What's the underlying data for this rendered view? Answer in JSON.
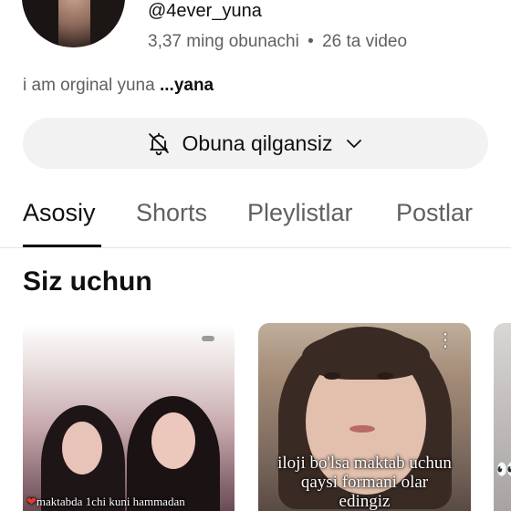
{
  "channel": {
    "handle": "@4ever_yuna",
    "subscribers": "3,37 ming obunachi",
    "separator": "•",
    "videos": "26 ta video",
    "bio": "i am orginal yuna",
    "bio_more": "...yana"
  },
  "subscribe_button": {
    "label": "Obuna qilgansiz",
    "icon": "bell-off-icon",
    "chevron": "chevron-down-icon"
  },
  "tabs": [
    {
      "label": "Asosiy",
      "active": true
    },
    {
      "label": "Shorts",
      "active": false
    },
    {
      "label": "Pleylistlar",
      "active": false
    },
    {
      "label": "Postlar",
      "active": false
    }
  ],
  "section": {
    "title": "Siz uchun"
  },
  "videos": [
    {
      "caption": "maktabda 1chi kuni hammadan"
    },
    {
      "caption_lines": [
        "iloji bo'lsa maktab uchun",
        "qaysi formani olar",
        "edingiz"
      ]
    },
    {
      "caption": "👀"
    }
  ],
  "colors": {
    "text_primary": "#0f0f0f",
    "text_secondary": "#606060",
    "button_bg": "#f2f2f2",
    "divider": "#e5e5e5"
  }
}
